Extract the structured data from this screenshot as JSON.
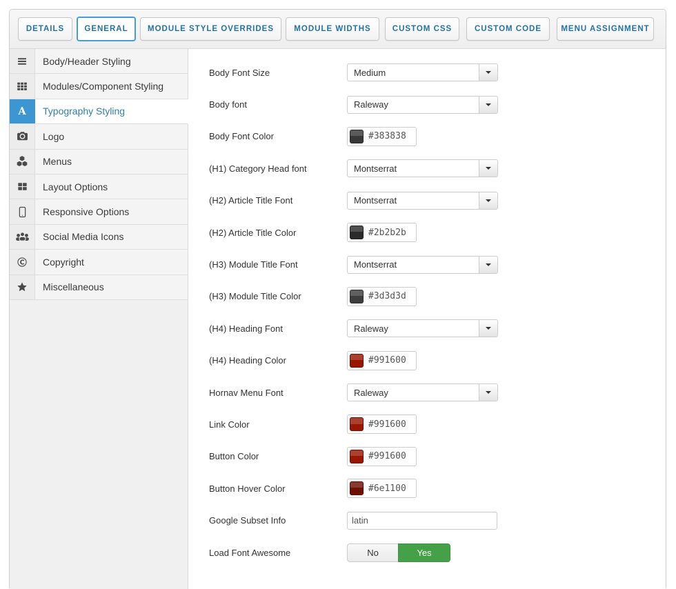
{
  "tabs": [
    {
      "label": "DETAILS",
      "active": false
    },
    {
      "label": "GENERAL",
      "active": true
    },
    {
      "label": "MODULE STYLE OVERRIDES",
      "active": false
    },
    {
      "label": "MODULE WIDTHS",
      "active": false
    },
    {
      "label": "CUSTOM CSS",
      "active": false
    },
    {
      "label": "CUSTOM CODE",
      "active": false
    },
    {
      "label": "MENU ASSIGNMENT",
      "active": false
    }
  ],
  "sidebar": {
    "items": [
      {
        "label": "Body/Header Styling",
        "icon": "bars-icon",
        "active": false
      },
      {
        "label": "Modules/Component Styling",
        "icon": "grid-icon",
        "active": false
      },
      {
        "label": "Typography Styling",
        "icon": "font-icon",
        "active": true
      },
      {
        "label": "Logo",
        "icon": "camera-icon",
        "active": false
      },
      {
        "label": "Menus",
        "icon": "cubes-icon",
        "active": false
      },
      {
        "label": "Layout Options",
        "icon": "layout-icon",
        "active": false
      },
      {
        "label": "Responsive Options",
        "icon": "tablet-icon",
        "active": false
      },
      {
        "label": "Social Media Icons",
        "icon": "users-icon",
        "active": false
      },
      {
        "label": "Copyright",
        "icon": "copyright-icon",
        "active": false
      },
      {
        "label": "Miscellaneous",
        "icon": "star-icon",
        "active": false
      }
    ]
  },
  "form": {
    "rows": [
      {
        "label": "Body Font Size",
        "type": "select",
        "value": "Medium"
      },
      {
        "label": "Body font",
        "type": "select",
        "value": "Raleway"
      },
      {
        "label": "Body Font Color",
        "type": "color",
        "value": "#383838"
      },
      {
        "label": "(H1) Category Head font",
        "type": "select",
        "value": "Montserrat"
      },
      {
        "label": "(H2) Article Title Font",
        "type": "select",
        "value": "Montserrat"
      },
      {
        "label": "(H2) Article Title Color",
        "type": "color",
        "value": "#2b2b2b"
      },
      {
        "label": "(H3) Module Title Font",
        "type": "select",
        "value": "Montserrat"
      },
      {
        "label": "(H3) Module Title Color",
        "type": "color",
        "value": "#3d3d3d"
      },
      {
        "label": "(H4) Heading Font",
        "type": "select",
        "value": "Raleway"
      },
      {
        "label": "(H4) Heading Color",
        "type": "color",
        "value": "#991600"
      },
      {
        "label": "Hornav Menu Font",
        "type": "select",
        "value": "Raleway"
      },
      {
        "label": "Link Color",
        "type": "color",
        "value": "#991600"
      },
      {
        "label": "Button Color",
        "type": "color",
        "value": "#991600"
      },
      {
        "label": "Button Hover Color",
        "type": "color",
        "value": "#6e1100"
      },
      {
        "label": "Google Subset Info",
        "type": "text",
        "value": "latin"
      },
      {
        "label": "Load Font Awesome",
        "type": "toggle",
        "options": [
          "No",
          "Yes"
        ],
        "value": "Yes"
      }
    ]
  },
  "colors": {
    "accent_blue": "#3b96d2",
    "tab_text_blue": "#2472a4",
    "active_tab_border": "#4a9bd4",
    "toggle_on_green": "#45a147"
  }
}
